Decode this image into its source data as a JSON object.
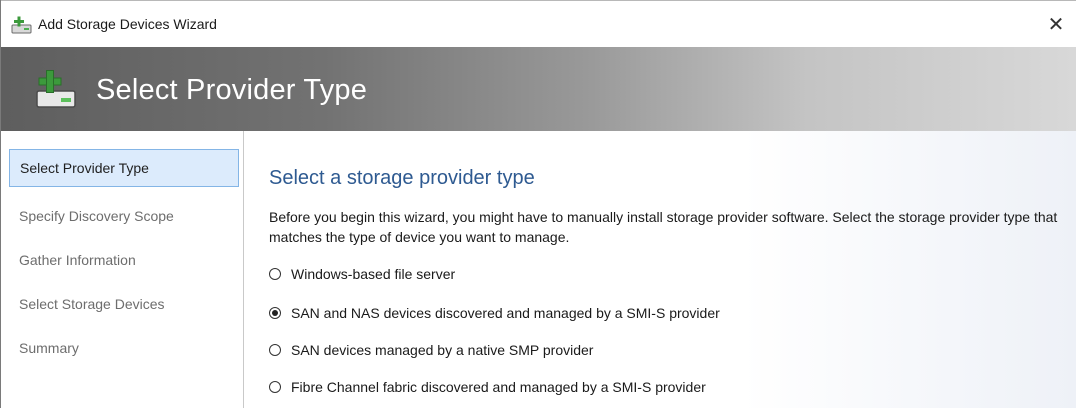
{
  "window": {
    "title": "Add Storage Devices Wizard",
    "close_glyph": "✕"
  },
  "banner": {
    "title": "Select Provider Type",
    "icon": "add-storage-icon"
  },
  "nav": {
    "items": [
      {
        "label": "Select Provider Type",
        "active": true
      },
      {
        "label": "Specify Discovery Scope",
        "active": false
      },
      {
        "label": "Gather Information",
        "active": false
      },
      {
        "label": "Select Storage Devices",
        "active": false
      },
      {
        "label": "Summary",
        "active": false
      }
    ]
  },
  "main": {
    "heading": "Select a storage provider type",
    "description": "Before you begin this wizard, you might have to manually install storage provider software. Select the storage provider type that matches the type of device you want to manage.",
    "options": [
      {
        "label": "Windows-based file server",
        "checked": false
      },
      {
        "label": "SAN and NAS devices discovered and managed by a SMI-S provider",
        "checked": true
      },
      {
        "label": "SAN devices managed by a native SMP provider",
        "checked": false
      },
      {
        "label": "Fibre Channel fabric discovered and managed by a SMI-S provider",
        "checked": false
      }
    ]
  },
  "colors": {
    "accent_heading": "#2e5a91",
    "nav_active_bg": "#dcebfc",
    "nav_active_border": "#84b5e6",
    "icon_green": "#3c9a3c"
  }
}
